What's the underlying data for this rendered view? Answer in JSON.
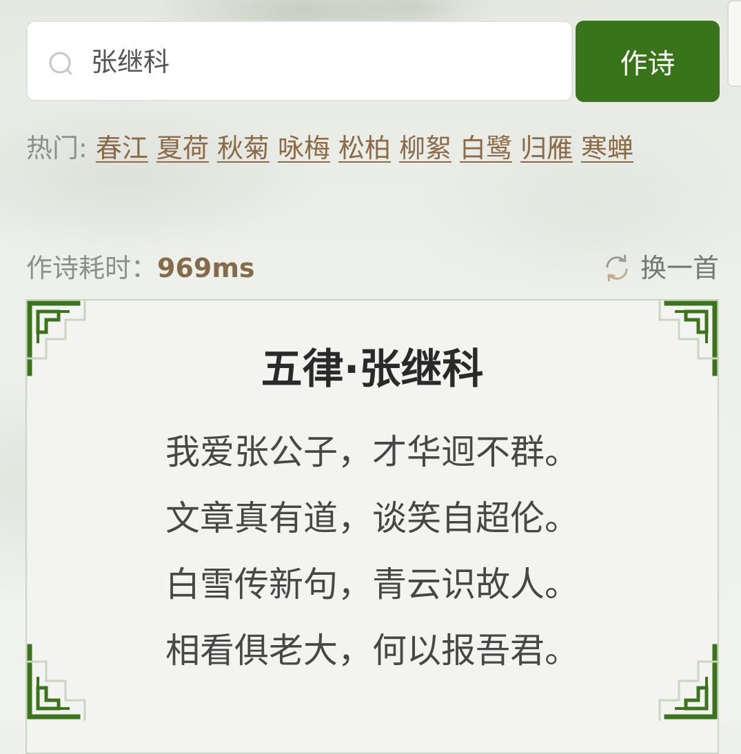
{
  "search": {
    "value": "张继科",
    "button_label": "作诗"
  },
  "hot": {
    "label": "热门:",
    "topics": [
      "春江",
      "夏荷",
      "秋菊",
      "咏梅",
      "松柏",
      "柳絮",
      "白鹭",
      "归雁",
      "寒蝉"
    ]
  },
  "timing": {
    "label": "作诗耗时：",
    "value": "969ms"
  },
  "refresh": {
    "label": "换一首"
  },
  "poem": {
    "title": "五律·张继科",
    "lines": [
      "我爱张公子，才华迥不群。",
      "文章真有道，谈笑自超伦。",
      "白雪传新句，青云识故人。",
      "相看俱老大，何以报吾君。"
    ]
  },
  "colors": {
    "accent": "#3a741a",
    "link": "#8b6a45",
    "timing_value": "#856b49",
    "card_border": "#c6d6bf"
  },
  "icons": [
    "search-icon",
    "refresh-icon",
    "lattice-corner-ornament"
  ]
}
